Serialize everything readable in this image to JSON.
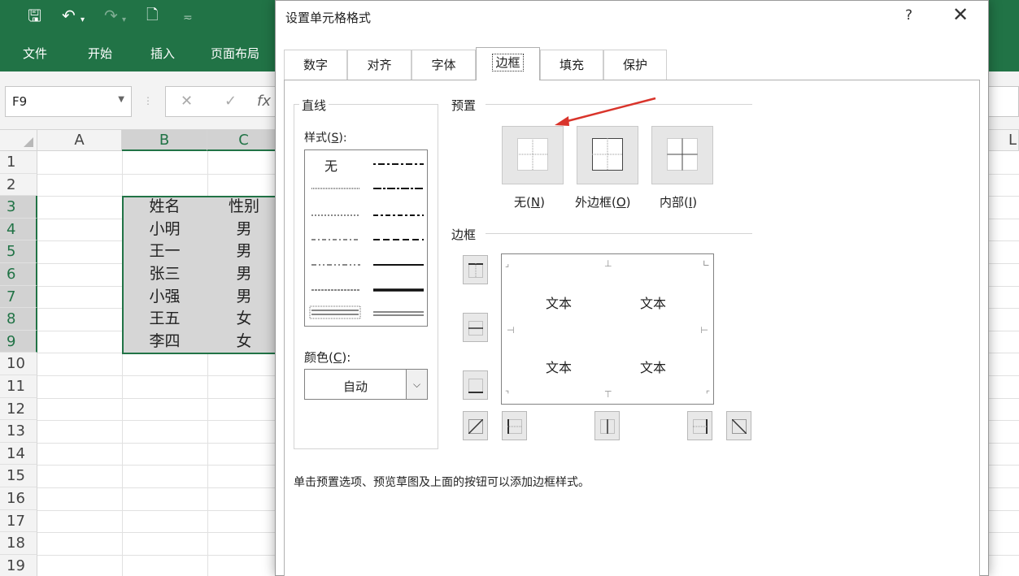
{
  "excel": {
    "menu": [
      "文件",
      "开始",
      "插入",
      "页面布局"
    ],
    "namebox": "F9",
    "fx": "fx",
    "columns": [
      "A",
      "B",
      "C"
    ],
    "rows": [
      "1",
      "2",
      "3",
      "4",
      "5",
      "6",
      "7",
      "8",
      "9",
      "10",
      "11",
      "12",
      "13",
      "14",
      "15",
      "16",
      "17",
      "18",
      "19"
    ],
    "table": {
      "headers": [
        "姓名",
        "性别"
      ],
      "rows": [
        [
          "小明",
          "男"
        ],
        [
          "王一",
          "男"
        ],
        [
          "张三",
          "男"
        ],
        [
          "小强",
          "男"
        ],
        [
          "王五",
          "女"
        ],
        [
          "李四",
          "女"
        ]
      ]
    },
    "right_edge_letter": "L"
  },
  "dialog": {
    "title": "设置单元格格式",
    "help": "?",
    "close": "✕",
    "tabs": [
      "数字",
      "对齐",
      "字体",
      "边框",
      "填充",
      "保护"
    ],
    "active_tab": "边框",
    "line_section": "直线",
    "style_label": "样式(",
    "style_key": "S",
    "style_label_end": "):",
    "style_none": "无",
    "color_label": "颜色(",
    "color_key": "C",
    "color_label_end": "):",
    "color_value": "自动",
    "presets_section": "预置",
    "presets": [
      {
        "label": "无(",
        "key": "N",
        "end": ")"
      },
      {
        "label": "外边框(",
        "key": "O",
        "end": ")"
      },
      {
        "label": "内部(",
        "key": "I",
        "end": ")"
      }
    ],
    "border_section": "边框",
    "preview_text": "文本",
    "hint": "单击预置选项、预览草图及上面的按钮可以添加边框样式。"
  },
  "colors": {
    "excel_green": "#217346",
    "annotation_arrow": "#d9342b"
  }
}
